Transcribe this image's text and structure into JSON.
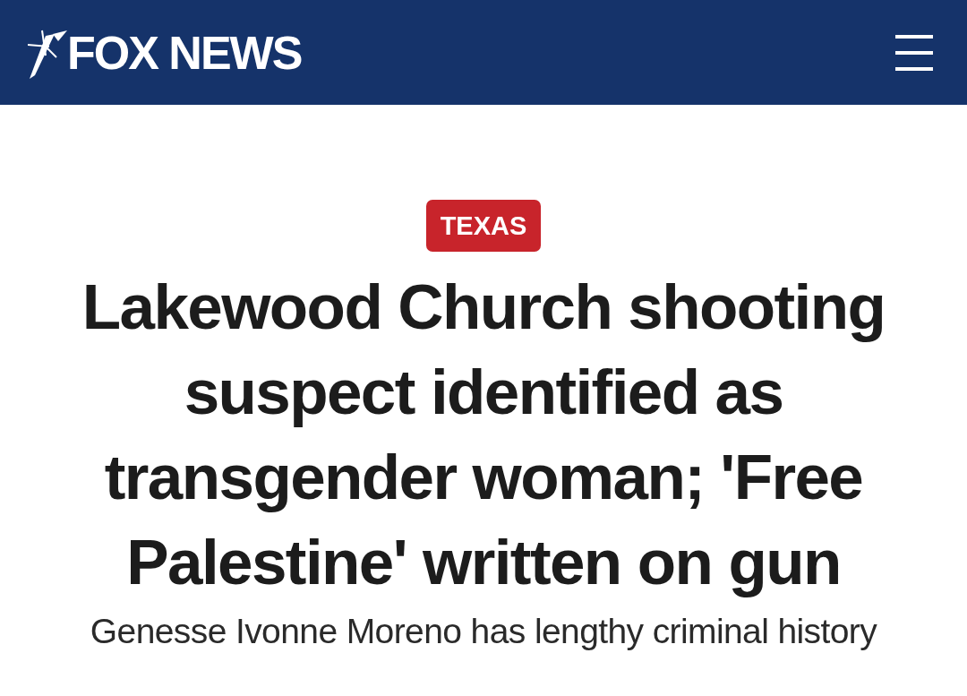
{
  "header": {
    "logo": "FOX NEWS"
  },
  "article": {
    "category": "TEXAS",
    "headline": "Lakewood Church shooting suspect identified as transgender woman; 'Free Palestine' written on gun",
    "subheadline": "Genesse Ivonne Moreno has lengthy criminal history"
  }
}
